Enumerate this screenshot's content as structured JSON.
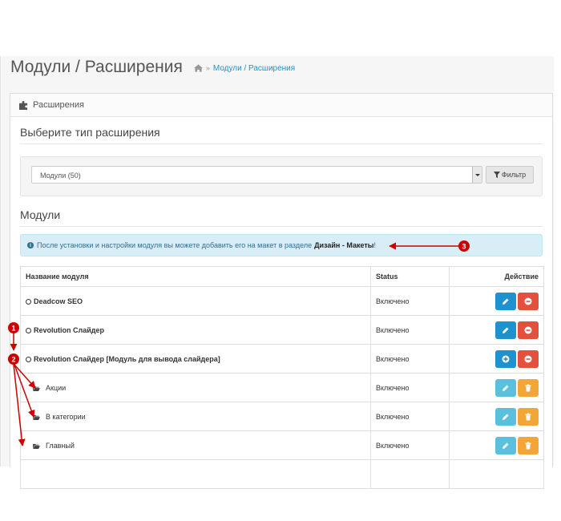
{
  "page": {
    "title": "Модули / Расширения",
    "breadcrumb": "Модули / Расширения"
  },
  "panel": {
    "heading": "Расширения",
    "type_legend": "Выберите тип расширения",
    "select_value": "Модули (50)",
    "filter_label": "Фильтр",
    "modules_legend": "Модули"
  },
  "alert": {
    "text": "После установки и настройки модуля вы можете добавить его на макет в разделе",
    "link": "Дизайн - Макеты",
    "suffix": "!"
  },
  "table": {
    "headers": {
      "name": "Название модуля",
      "status": "Status",
      "action": "Действие"
    },
    "rows": [
      {
        "name": "Deadcow SEO",
        "status": "Включено"
      },
      {
        "name": "Revolution Слайдер",
        "status": "Включено"
      },
      {
        "name": "Revolution Слайдер [Модуль для вывода слайдера]",
        "status": "Включено"
      },
      {
        "name": "Акции",
        "status": "Включено"
      },
      {
        "name": "В категории",
        "status": "Включено"
      },
      {
        "name": "Главный",
        "status": "Включено"
      }
    ]
  },
  "annotations": [
    "1",
    "2",
    "3"
  ],
  "colors": {
    "accent": "#1e91cf",
    "danger": "#e3503e",
    "info": "#5bc0de",
    "warning": "#f3a638",
    "annotation": "#cc0000"
  }
}
